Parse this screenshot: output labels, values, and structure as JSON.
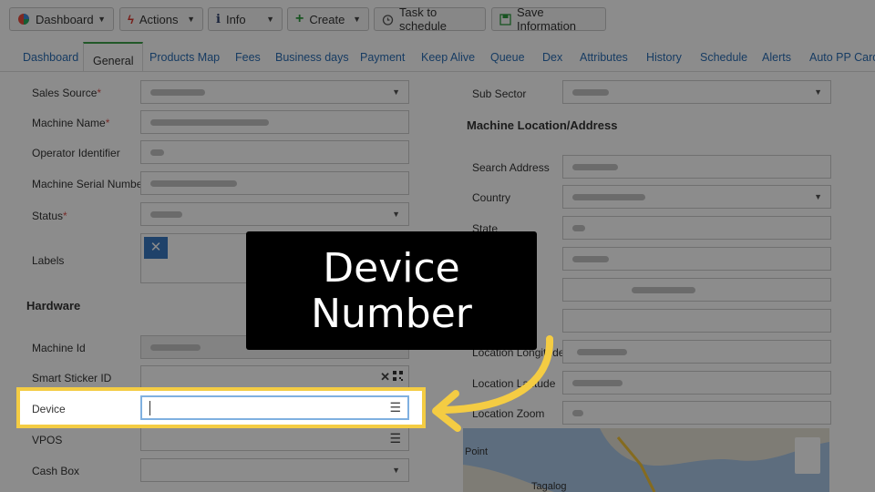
{
  "toolbar": {
    "dashboard": "Dashboard",
    "actions": "Actions",
    "info": "Info",
    "create": "Create",
    "task": "Task to schedule",
    "save": "Save Information"
  },
  "tabs": [
    "Dashboard",
    "General",
    "Products Map",
    "Fees",
    "Business days",
    "Payment",
    "Keep Alive",
    "Queue",
    "Dex",
    "Attributes",
    "History",
    "Schedule",
    "Alerts",
    "Auto PP Cards"
  ],
  "form_left": {
    "sales_source": "Sales Source",
    "machine_name": "Machine Name",
    "operator_identifier": "Operator Identifier",
    "machine_serial_number": "Machine Serial Number",
    "status": "Status",
    "labels": "Labels",
    "hardware": "Hardware",
    "machine_id": "Machine Id",
    "smart_sticker_id": "Smart Sticker ID",
    "device": "Device",
    "vpos": "VPOS",
    "cash_box": "Cash Box",
    "required_mark": "*"
  },
  "form_right": {
    "sub_sector": "Sub Sector",
    "location_heading": "Machine Location/Address",
    "search_address": "Search Address",
    "country": "Country",
    "state": "State",
    "location_longitude": "Location Longitude",
    "location_latitude": "Location Latitude",
    "location_zoom": "Location Zoom"
  },
  "map": {
    "label_point": "Point",
    "label_place": "Tagalog"
  },
  "callout": {
    "line1": "Device",
    "line2": "Number"
  },
  "colors": {
    "highlight": "#f4cc43",
    "link": "#2a6db4",
    "active_tab": "#3da04a",
    "label_button": "#3a79c1"
  }
}
